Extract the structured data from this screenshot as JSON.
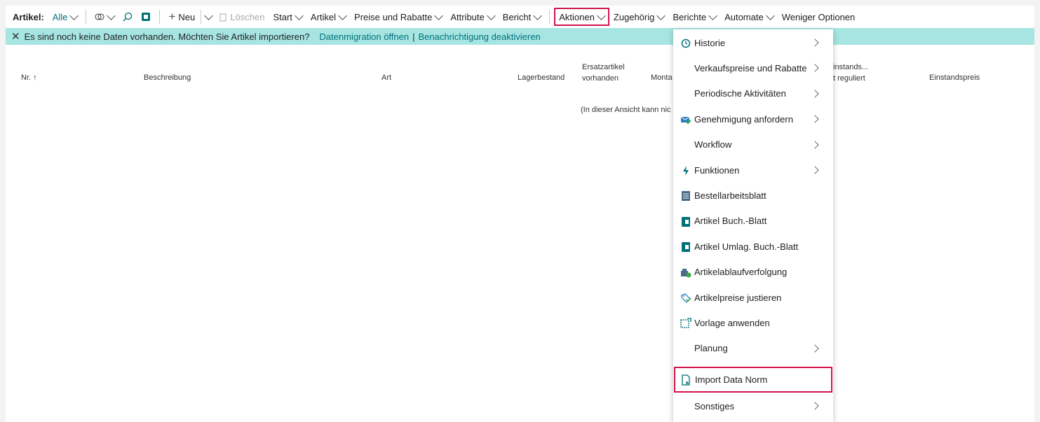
{
  "toolbar": {
    "title": "Artikel:",
    "filter": "Alle",
    "new_label": "Neu",
    "delete_label": "Löschen",
    "start": "Start",
    "artikel": "Artikel",
    "preise": "Preise und Rabatte",
    "attribute": "Attribute",
    "bericht": "Bericht",
    "aktionen": "Aktionen",
    "zugehoerig": "Zugehörig",
    "berichte": "Berichte",
    "automate": "Automate",
    "weniger": "Weniger Optionen"
  },
  "infobar": {
    "message": "Es sind noch keine Daten vorhanden. Möchten Sie Artikel importieren?",
    "link1": "Datenmigration öffnen",
    "separator": "|",
    "link2": "Benachrichtigung deaktivieren"
  },
  "columns": {
    "nr": "Nr. ↑",
    "beschreibung": "Beschreibung",
    "art": "Art",
    "lagerbestand": "Lagerbestand",
    "ersatz1": "Ersatzartikel",
    "ersatz2": "vorhanden",
    "monta": "Monta",
    "einstands_partial1": "instands...",
    "einstands_partial2": "t reguliert",
    "einstandspreis": "Einstandspreis"
  },
  "empty_message": "(In dieser Ansicht kann nic",
  "menu": {
    "items": [
      {
        "label": "Historie",
        "icon": "history-icon",
        "submenu": true
      },
      {
        "label": "Verkaufspreise und Rabatte",
        "icon": "",
        "submenu": true
      },
      {
        "label": "Periodische Aktivitäten",
        "icon": "",
        "submenu": true
      },
      {
        "label": "Genehmigung anfordern",
        "icon": "approval-icon",
        "submenu": true
      },
      {
        "label": "Workflow",
        "icon": "",
        "submenu": true
      },
      {
        "label": "Funktionen",
        "icon": "lightning-icon",
        "submenu": true
      },
      {
        "label": "Bestellarbeitsblatt",
        "icon": "worksheet-icon",
        "submenu": false
      },
      {
        "label": "Artikel Buch.-Blatt",
        "icon": "journal-icon",
        "submenu": false
      },
      {
        "label": "Artikel Umlag. Buch.-Blatt",
        "icon": "journal-icon",
        "submenu": false
      },
      {
        "label": "Artikelablaufverfolgung",
        "icon": "tracing-icon",
        "submenu": false
      },
      {
        "label": "Artikelpreise justieren",
        "icon": "price-adjust-icon",
        "submenu": false
      },
      {
        "label": "Vorlage anwenden",
        "icon": "template-icon",
        "submenu": false
      },
      {
        "label": "Planung",
        "icon": "",
        "submenu": true
      },
      {
        "label": "Import Data Norm",
        "icon": "import-icon",
        "submenu": false
      },
      {
        "label": "Sonstiges",
        "icon": "",
        "submenu": true
      }
    ]
  },
  "colors": {
    "accent": "#00707a",
    "infobar": "#a6e5e2",
    "highlight": "#d0144a"
  }
}
